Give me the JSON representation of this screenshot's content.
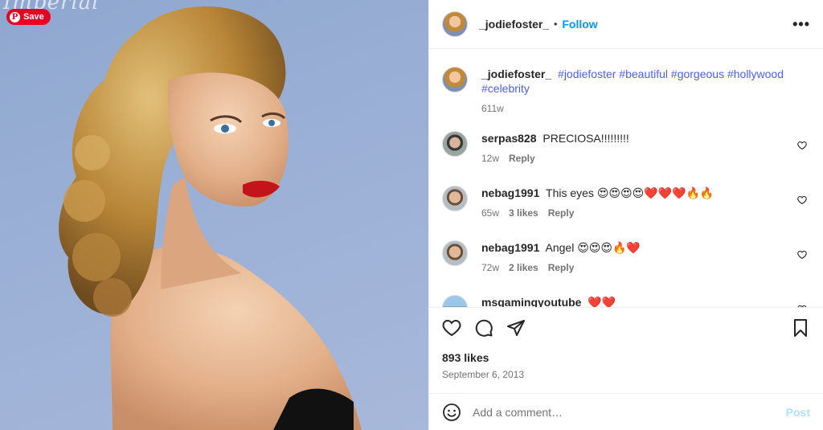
{
  "pin": {
    "save_label": "Save",
    "pin_glyph": "P",
    "brand_color": "#e60023"
  },
  "photo": {
    "masthead_text": "Imperial"
  },
  "post": {
    "username": "_jodiefoster_",
    "separator": "•",
    "follow_label": "Follow",
    "more_label": "•••",
    "caption": {
      "username": "_jodiefoster_",
      "hashtags": "#jodiefoster #beautiful #gorgeous #hollywood #celebrity",
      "time": "611w"
    },
    "comments": [
      {
        "username": "serpas828",
        "text": "PRECIOSA!!!!!!!!!",
        "time": "12w",
        "likes": "",
        "reply": "Reply"
      },
      {
        "username": "nebag1991",
        "text": "This eyes 😍😍😍😍❤️❤️❤️🔥🔥",
        "time": "65w",
        "likes": "3 likes",
        "reply": "Reply"
      },
      {
        "username": "nebag1991",
        "text": "Angel 😍😍😍🔥❤️",
        "time": "72w",
        "likes": "2 likes",
        "reply": "Reply"
      },
      {
        "username": "msgamingyoutube",
        "text": "❤️❤️",
        "time": "",
        "likes": "",
        "reply": ""
      }
    ],
    "likes_count": "893 likes",
    "date": "September 6, 2013",
    "add_comment_placeholder": "Add a comment…",
    "post_label": "Post"
  },
  "colors": {
    "follow_blue": "#0095f6",
    "hashtag_blue": "#4f5ee8",
    "post_disabled": "#b2dffc"
  },
  "icons": [
    "heart-icon",
    "comment-icon",
    "share-icon",
    "bookmark-icon",
    "emoji-icon",
    "more-icon"
  ]
}
